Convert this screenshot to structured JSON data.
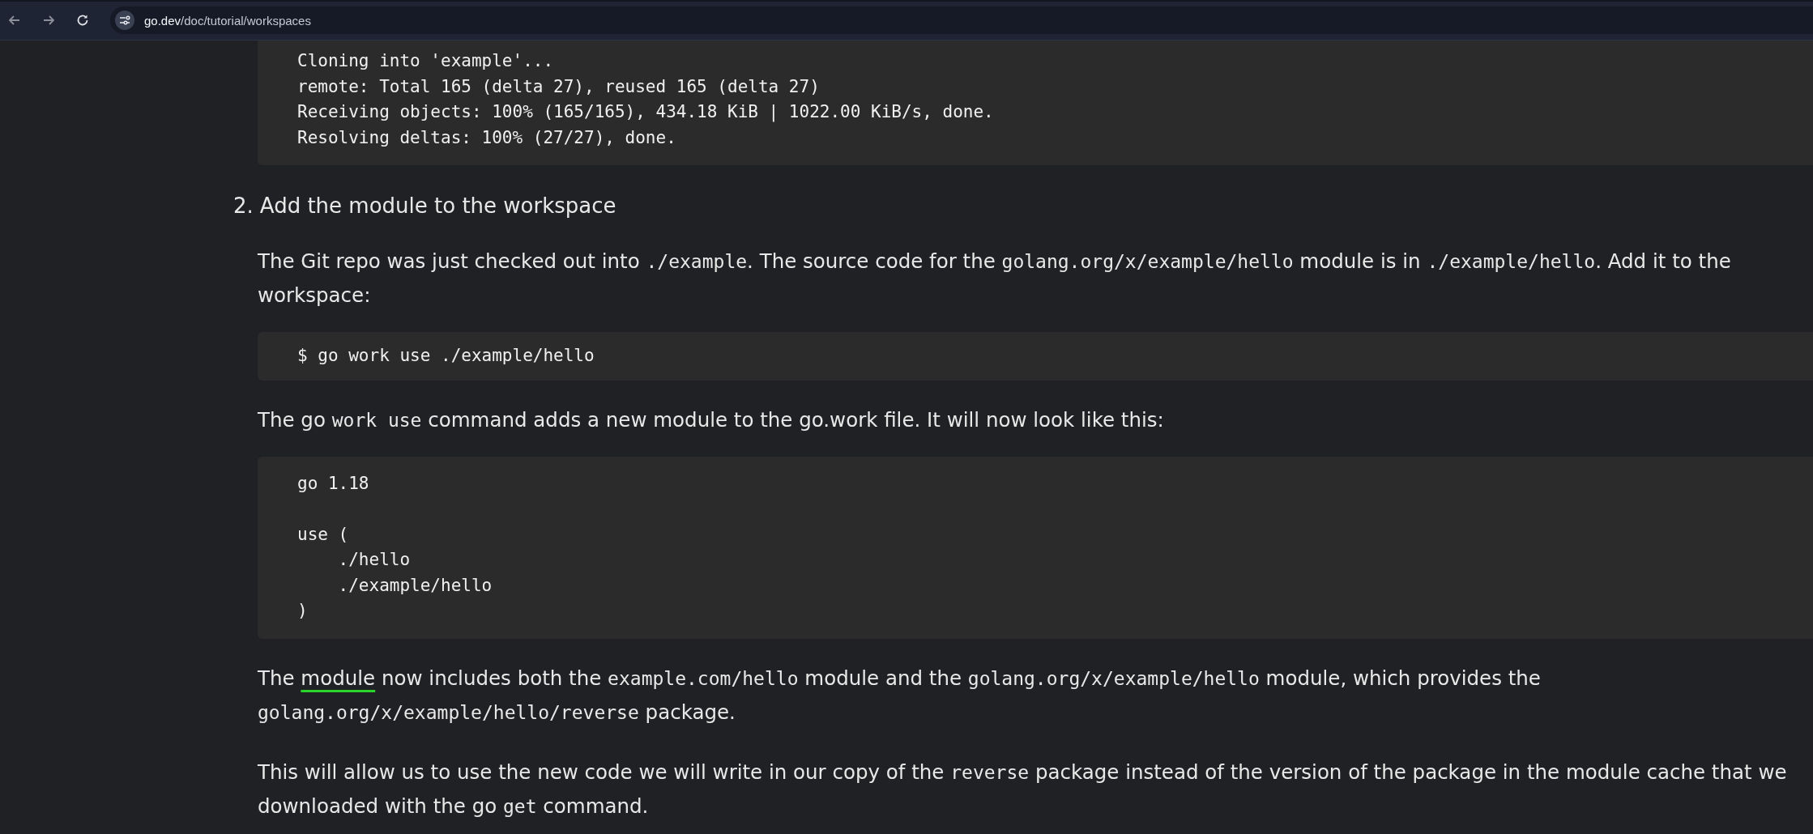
{
  "browser": {
    "url_host": "go.dev",
    "url_path": "/doc/tutorial/workspaces"
  },
  "blocks": [
    {
      "kind": "code",
      "groups": [
        [
          "Cloning into 'example'...",
          "remote: Total 165 (delta 27), reused 165 (delta 27)",
          "Receiving objects: 100% (165/165), 434.18 KiB | 1022.00 KiB/s, done.",
          "Resolving deltas: 100% (27/27), done."
        ]
      ]
    },
    {
      "kind": "heading",
      "number": "2.",
      "text": "Add the module to the workspace"
    },
    {
      "kind": "paragraph",
      "segments": [
        {
          "kind": "text",
          "text": "The Git repo was just checked out into "
        },
        {
          "kind": "code",
          "text": "./example"
        },
        {
          "kind": "text",
          "text": ". The source code for the "
        },
        {
          "kind": "code",
          "text": "golang.org/x/example/hello"
        },
        {
          "kind": "text",
          "text": " module is in "
        },
        {
          "kind": "code",
          "text": "./example/hello"
        },
        {
          "kind": "text",
          "text": ". Add it to the workspace:"
        }
      ]
    },
    {
      "kind": "code",
      "groups": [
        [
          "$ go work use ./example/hello"
        ]
      ]
    },
    {
      "kind": "paragraph",
      "segments": [
        {
          "kind": "text",
          "text": "The go "
        },
        {
          "kind": "code",
          "text": "work use"
        },
        {
          "kind": "text",
          "text": " command adds a new module to the go.work file. It will now look like this:"
        }
      ]
    },
    {
      "kind": "code",
      "groups": [
        [
          "go 1.18"
        ],
        [
          "use (",
          "    ./hello",
          "    ./example/hello",
          ")"
        ]
      ]
    },
    {
      "kind": "paragraph",
      "segments": [
        {
          "kind": "text",
          "text": "The "
        },
        {
          "kind": "link",
          "text": "module"
        },
        {
          "kind": "text",
          "text": " now includes both the "
        },
        {
          "kind": "code",
          "text": "example.com/hello"
        },
        {
          "kind": "text",
          "text": " module and the "
        },
        {
          "kind": "code",
          "text": "golang.org/x/example/hello"
        },
        {
          "kind": "text",
          "text": " module, which provides the "
        },
        {
          "kind": "code",
          "text": "golang.org/x/example/hello/reverse"
        },
        {
          "kind": "text",
          "text": " package."
        }
      ]
    },
    {
      "kind": "paragraph",
      "segments": [
        {
          "kind": "text",
          "text": "This will allow us to use the new code we will write in our copy of the "
        },
        {
          "kind": "code",
          "text": "reverse"
        },
        {
          "kind": "text",
          "text": " package instead of the version of the package in the module cache that we downloaded with the go "
        },
        {
          "kind": "code",
          "text": "get"
        },
        {
          "kind": "text",
          "text": " command."
        }
      ]
    }
  ]
}
